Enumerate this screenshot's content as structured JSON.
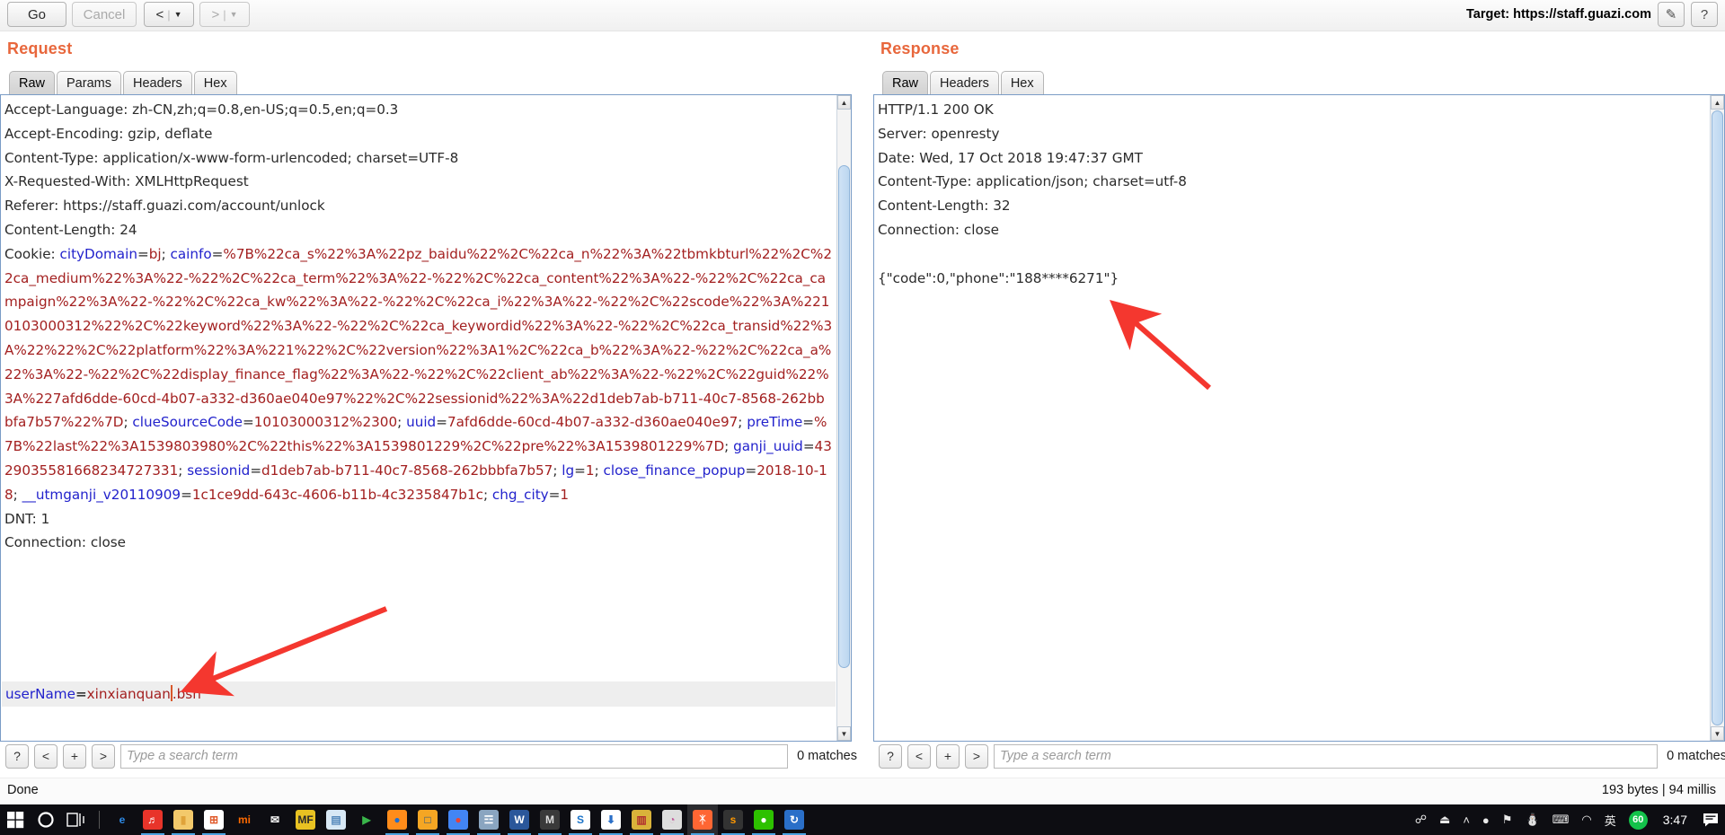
{
  "toolbar": {
    "go_label": "Go",
    "cancel_label": "Cancel",
    "prev_label": "<",
    "next_label": ">",
    "caret": "▼",
    "divider": "|",
    "target_label": "Target: https://staff.guazi.com",
    "edit_icon": "✎",
    "help_icon": "?"
  },
  "request": {
    "title": "Request",
    "tabs": [
      "Raw",
      "Params",
      "Headers",
      "Hex"
    ],
    "active_tab": "Raw",
    "headers": [
      "Accept-Language: zh-CN,zh;q=0.8,en-US;q=0.5,en;q=0.3",
      "Accept-Encoding: gzip, deflate",
      "Content-Type: application/x-www-form-urlencoded; charset=UTF-8",
      "X-Requested-With: XMLHttpRequest",
      "Referer: https://staff.guazi.com/account/unlock",
      "Content-Length: 24"
    ],
    "cookie_prefix": "Cookie: ",
    "cookies": [
      {
        "name": "cityDomain",
        "value": "bj"
      },
      {
        "name": "cainfo",
        "value": "%7B%22ca_s%22%3A%22pz_baidu%22%2C%22ca_n%22%3A%22tbmkbturl%22%2C%22ca_medium%22%3A%22-%22%2C%22ca_term%22%3A%22-%22%2C%22ca_content%22%3A%22-%22%2C%22ca_campaign%22%3A%22-%22%2C%22ca_kw%22%3A%22-%22%2C%22ca_i%22%3A%22-%22%2C%22scode%22%3A%2210103000312%22%2C%22keyword%22%3A%22-%22%2C%22ca_keywordid%22%3A%22-%22%2C%22ca_transid%22%3A%22%22%2C%22platform%22%3A%221%22%2C%22version%22%3A1%2C%22ca_b%22%3A%22-%22%2C%22ca_a%22%3A%22-%22%2C%22display_finance_flag%22%3A%22-%22%2C%22client_ab%22%3A%22-%22%2C%22guid%22%3A%227afd6dde-60cd-4b07-a332-d360ae040e97%22%2C%22sessionid%22%3A%22d1deb7ab-b711-40c7-8568-262bbbfa7b57%22%7D"
      },
      {
        "name": "clueSourceCode",
        "value": "10103000312%2300"
      },
      {
        "name": "uuid",
        "value": "7afd6dde-60cd-4b07-a332-d360ae040e97"
      },
      {
        "name": "preTime",
        "value": "%7B%22last%22%3A1539803980%2C%22this%22%3A1539801229%2C%22pre%22%3A1539801229%7D"
      },
      {
        "name": "ganji_uuid",
        "value": "4329035581668234727331"
      },
      {
        "name": "sessionid",
        "value": "d1deb7ab-b711-40c7-8568-262bbbfa7b57"
      },
      {
        "name": "lg",
        "value": "1"
      },
      {
        "name": "close_finance_popup",
        "value": "2018-10-18"
      },
      {
        "name": "__utmganji_v20110909",
        "value": "1c1ce9dd-643c-4606-b11b-4c3235847b1c"
      },
      {
        "name": "chg_city",
        "value": "1"
      }
    ],
    "trailing_headers": [
      "DNT: 1",
      "Connection: close"
    ],
    "body_param_name": "userName",
    "body_param_value_before_caret": "xinxianquan",
    "body_param_value_after_caret": ".bsn",
    "search": {
      "help_label": "?",
      "prev_label": "<",
      "add_label": "+",
      "next_label": ">",
      "placeholder": "Type a search term",
      "value": "",
      "matches": "0 matches"
    }
  },
  "response": {
    "title": "Response",
    "tabs": [
      "Raw",
      "Headers",
      "Hex"
    ],
    "active_tab": "Raw",
    "lines": [
      "HTTP/1.1 200 OK",
      "Server: openresty",
      "Date: Wed, 17 Oct 2018 19:47:37 GMT",
      "Content-Type: application/json; charset=utf-8",
      "Content-Length: 32",
      "Connection: close",
      "",
      "{\"code\":0,\"phone\":\"188****6271\"}"
    ],
    "search": {
      "help_label": "?",
      "prev_label": "<",
      "add_label": "+",
      "next_label": ">",
      "placeholder": "Type a search term",
      "value": "",
      "matches": "0 matches"
    }
  },
  "statusbar": {
    "left": "Done",
    "right": "193 bytes | 94 millis"
  },
  "annotations": {
    "arrow_color": "#f4372f",
    "arrow_request_target": "userName caret position",
    "arrow_response_target": "phone value in JSON body"
  },
  "taskbar": {
    "start_icon": "windows-logo",
    "search_icon": "cortana-circle",
    "taskview_icon": "task-view",
    "apps": [
      {
        "name": "edge",
        "glyph": "e",
        "bg": "transparent",
        "fg": "#2e8ae6",
        "running": false
      },
      {
        "name": "qq-music",
        "glyph": "♬",
        "bg": "#e8342a",
        "fg": "#ffffff",
        "running": true
      },
      {
        "name": "file-explorer",
        "glyph": "▮",
        "bg": "#f3c96b",
        "fg": "#e0a33a",
        "running": true
      },
      {
        "name": "microsoft-store",
        "glyph": "⊞",
        "bg": "#ffffff",
        "fg": "#e05a2b",
        "running": true
      },
      {
        "name": "xiaomi",
        "glyph": "mi",
        "bg": "transparent",
        "fg": "#ff6a00",
        "running": false
      },
      {
        "name": "mail",
        "glyph": "✉",
        "bg": "transparent",
        "fg": "#ffffff",
        "running": false
      },
      {
        "name": "mf-app",
        "glyph": "MF",
        "bg": "#e8c222",
        "fg": "#2a2a2a",
        "running": false
      },
      {
        "name": "notepad",
        "glyph": "▤",
        "bg": "#d8e8f5",
        "fg": "#5588bb",
        "running": false
      },
      {
        "name": "play-store",
        "glyph": "▶",
        "bg": "transparent",
        "fg": "#39b54a",
        "running": false
      },
      {
        "name": "firefox",
        "glyph": "●",
        "bg": "#ff8c1a",
        "fg": "#1f6fd0",
        "running": true
      },
      {
        "name": "sandbox",
        "glyph": "□",
        "bg": "#f5a623",
        "fg": "#1a4f8a",
        "running": true
      },
      {
        "name": "chrome",
        "glyph": "●",
        "bg": "#4285f4",
        "fg": "#ea4335",
        "running": true
      },
      {
        "name": "editplus",
        "glyph": "☲",
        "bg": "#8aa5c0",
        "fg": "#ffffff",
        "running": true
      },
      {
        "name": "word",
        "glyph": "W",
        "bg": "#2b579a",
        "fg": "#ffffff",
        "running": true
      },
      {
        "name": "markdown",
        "glyph": "M",
        "bg": "#3a3a3a",
        "fg": "#dddddd",
        "running": true
      },
      {
        "name": "sogou",
        "glyph": "S",
        "bg": "#ffffff",
        "fg": "#1a73c8",
        "running": true
      },
      {
        "name": "downloader",
        "glyph": "⬇",
        "bg": "#ffffff",
        "fg": "#2a6fc8",
        "running": true
      },
      {
        "name": "winrar",
        "glyph": "▥",
        "bg": "#d9b23a",
        "fg": "#b03030",
        "running": true
      },
      {
        "name": "photos",
        "glyph": "◔",
        "bg": "#dddddd",
        "fg": "#c05a9a",
        "running": true
      },
      {
        "name": "burp-suite",
        "glyph": "ᛡ",
        "bg": "#ff6633",
        "fg": "#ffffff",
        "running": true,
        "active": true
      },
      {
        "name": "sublime-text",
        "glyph": "s",
        "bg": "#333333",
        "fg": "#ff9800",
        "running": true
      },
      {
        "name": "wechat",
        "glyph": "●",
        "bg": "#2dc100",
        "fg": "#ffffff",
        "running": true
      },
      {
        "name": "foxit-reader",
        "glyph": "↻",
        "bg": "#2a6fc8",
        "fg": "#ffffff",
        "running": true
      }
    ],
    "tray": [
      {
        "name": "people-icon",
        "glyph": "☍"
      },
      {
        "name": "usb-eject-icon",
        "glyph": "⏏"
      },
      {
        "name": "show-hidden-icons-chevron",
        "glyph": "˄"
      },
      {
        "name": "wechat-tray-icon",
        "glyph": "●"
      },
      {
        "name": "qq-tray-icon",
        "glyph": "⚑"
      },
      {
        "name": "penguin-icon",
        "glyph": "⛄"
      },
      {
        "name": "keyboard-icon",
        "glyph": "⌨"
      },
      {
        "name": "wifi-icon",
        "glyph": "◠"
      },
      {
        "name": "ime-language-icon",
        "glyph": "英"
      }
    ],
    "battery_level": "60",
    "clock": "3:47",
    "action_center_icon": "☷"
  }
}
